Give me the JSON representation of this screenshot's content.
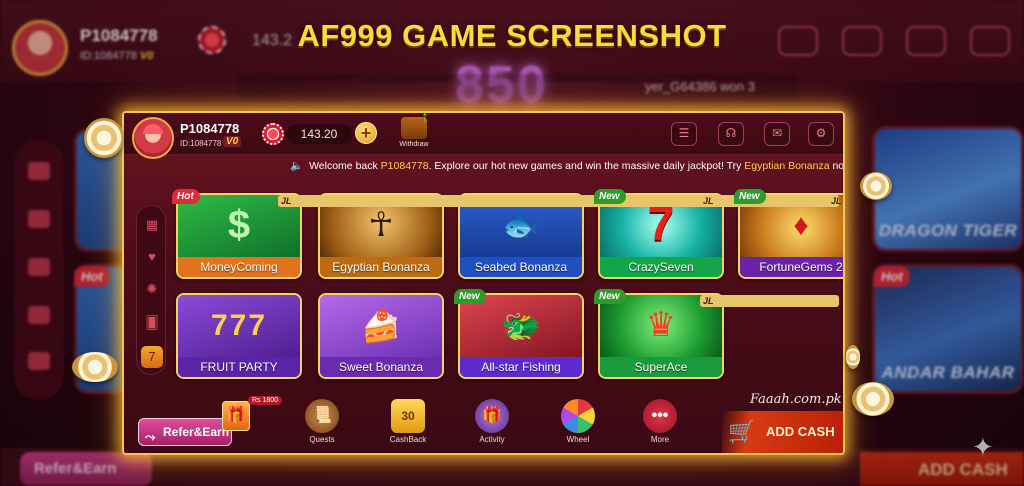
{
  "banner": {
    "title": "AF999 GAME SCREENSHOT"
  },
  "background": {
    "username": "P1084778",
    "user_id": "ID:1084778",
    "vip": "V0",
    "balance": "143.2",
    "jackpot": "850",
    "ticker": "yer_G64386 won 3",
    "tiles": {
      "dragon_tiger": "DRAGON TIGER",
      "andar_bahar": "ANDAR BAHAR",
      "hot": "Hot"
    },
    "refer_label": "Refer&Earn",
    "addcash_label": "ADD CASH"
  },
  "header": {
    "username": "P1084778",
    "user_id": "ID:1084778",
    "vip": "V0",
    "balance": "143.20",
    "add_symbol": "+",
    "withdraw_label": "Withdraw",
    "icons": [
      "list-icon",
      "headset-icon",
      "mail-icon",
      "gear-icon"
    ]
  },
  "marquee": {
    "prefix": "Welcome back ",
    "username": "P1084778",
    "middle": ". Explore our hot new games and win the massive daily jackpot! Try ",
    "game": "Egyptian Bonanza",
    "suffix": " now!"
  },
  "side_nav": [
    "grid-icon",
    "heart-icon",
    "chip-icon",
    "cards-icon",
    "slot-icon"
  ],
  "games": [
    {
      "label": "MoneyComing",
      "badge": "Hot",
      "provider": "JL"
    },
    {
      "label": "Egyptian Bonanza",
      "badge": "",
      "provider": ""
    },
    {
      "label": "Seabed Bonanza",
      "badge": "",
      "provider": ""
    },
    {
      "label": "CrazySeven",
      "badge": "New",
      "provider": "JL"
    },
    {
      "label": "FortuneGems 2",
      "badge": "New",
      "provider": "JL"
    },
    {
      "label": "FRUIT PARTY",
      "badge": "",
      "provider": ""
    },
    {
      "label": "Sweet Bonanza",
      "badge": "",
      "provider": ""
    },
    {
      "label": "All-star Fishing",
      "badge": "New",
      "provider": ""
    },
    {
      "label": "SuperAce",
      "badge": "New",
      "provider": "JL"
    }
  ],
  "bottom_bar": {
    "refer_label": "Refer&Earn",
    "reward_tag": "Rs 1800",
    "items": [
      {
        "label": "Quests",
        "icon": "scroll-icon"
      },
      {
        "label": "CashBack",
        "icon": "cashback-icon"
      },
      {
        "label": "Activity",
        "icon": "gift-icon"
      },
      {
        "label": "Wheel",
        "icon": "wheel-icon"
      },
      {
        "label": "More",
        "icon": "more-icon"
      }
    ],
    "watermark": "Faaah.com.pk",
    "addcash_label": "ADD CASH"
  },
  "colors": {
    "accent_gold": "#f6c64b",
    "banner_yellow": "#ffd83a",
    "bg_maroon": "#4c0c18"
  }
}
